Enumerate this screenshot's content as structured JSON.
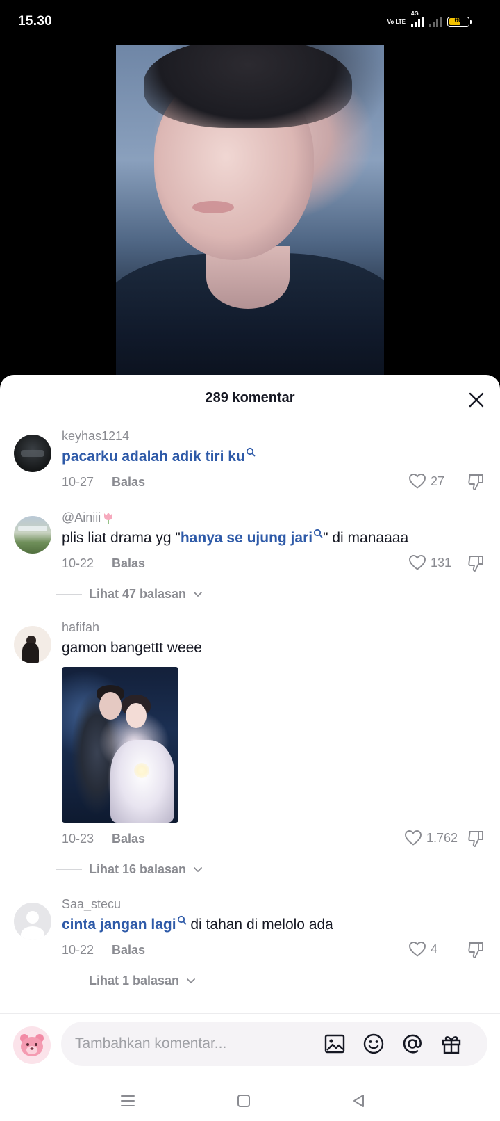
{
  "status_bar": {
    "time": "15.30",
    "volte": "Vo LTE",
    "network": "4G",
    "battery": "60"
  },
  "sheet": {
    "title": "289 komentar"
  },
  "comments": [
    {
      "username": "keyhas1214",
      "text_link": "pacarku adalah adik tiri ku",
      "text_after": "",
      "date": "10-27",
      "reply_label": "Balas",
      "likes": "27"
    },
    {
      "username": "@Ainiii",
      "username_emoji": "tulip-icon",
      "text_before": "plis liat drama yg \"",
      "text_link": "hanya se ujung jari",
      "text_after": "\" di manaaaa",
      "date": "10-22",
      "reply_label": "Balas",
      "likes": "131",
      "view_replies": "Lihat 47 balasan"
    },
    {
      "username": "hafifah",
      "text": "gamon bangettt weee",
      "date": "10-23",
      "reply_label": "Balas",
      "likes": "1.762",
      "view_replies": "Lihat 16 balasan"
    },
    {
      "username": "Saa_stecu",
      "text_link": "cinta jangan lagi",
      "text_after": " di tahan di melolo ada",
      "date": "10-22",
      "reply_label": "Balas",
      "likes": "4",
      "view_replies": "Lihat 1 balasan"
    }
  ],
  "input": {
    "placeholder": "Tambahkan komentar..."
  },
  "colors": {
    "link": "#2e5aa8",
    "muted": "#8a8b91",
    "text": "#161823",
    "input_bg": "#f5f3f6"
  }
}
